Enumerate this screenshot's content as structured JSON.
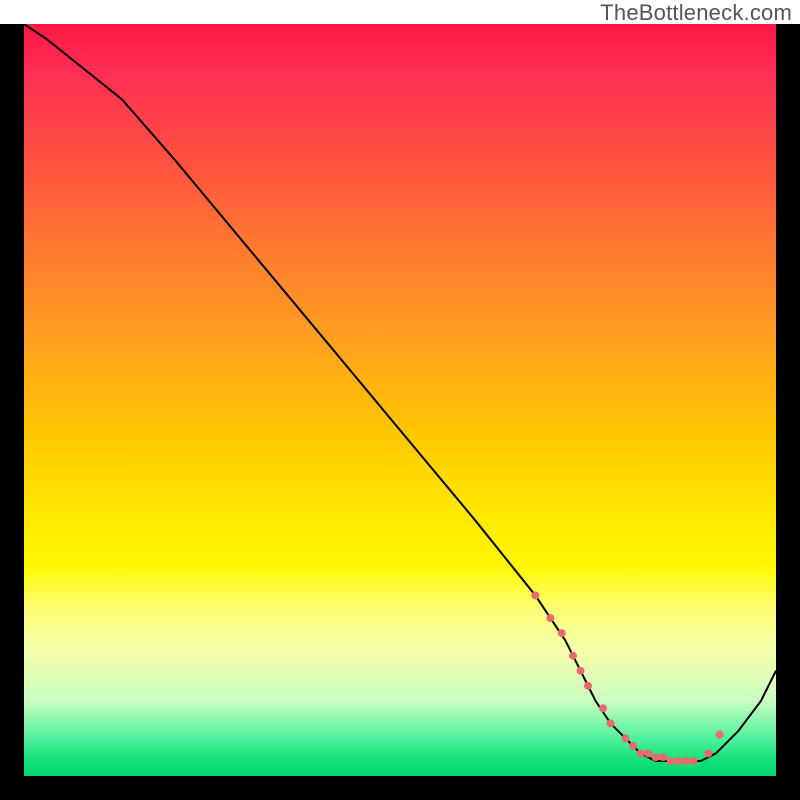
{
  "watermark": "TheBottleneck.com",
  "colors": {
    "curve_stroke": "#000000",
    "marker_fill": "#e86a6a",
    "background_black": "#000000"
  },
  "chart_data": {
    "type": "line",
    "title": "",
    "xlabel": "",
    "ylabel": "",
    "xlim": [
      0,
      100
    ],
    "ylim": [
      0,
      100
    ],
    "grid": false,
    "legend": false,
    "annotations": [
      "TheBottleneck.com"
    ],
    "series": [
      {
        "name": "curve",
        "x": [
          0,
          3,
          8,
          13,
          20,
          30,
          40,
          50,
          60,
          68,
          72,
          74,
          76,
          78,
          80,
          82,
          84,
          86,
          88,
          90,
          92,
          95,
          98,
          100
        ],
        "y": [
          100,
          98,
          94,
          90,
          82,
          70,
          58,
          46,
          34,
          24,
          18,
          14,
          10,
          7,
          5,
          3,
          2,
          2,
          2,
          2,
          3,
          6,
          10,
          14
        ]
      }
    ],
    "markers": {
      "name": "highlight-markers",
      "x": [
        68,
        70,
        71.5,
        73,
        74,
        75,
        77,
        78,
        80,
        81,
        82,
        83,
        84,
        85,
        86,
        87,
        88,
        89,
        91,
        92.5
      ],
      "y": [
        24,
        21,
        19,
        16,
        14,
        12,
        9,
        7,
        5,
        4,
        3,
        3,
        2.5,
        2.5,
        2,
        2,
        2,
        2,
        3,
        5.5
      ],
      "radius": 4
    },
    "gradient_stops": [
      {
        "pos": 0.0,
        "color": "#ff1744"
      },
      {
        "pos": 0.18,
        "color": "#ff5040"
      },
      {
        "pos": 0.42,
        "color": "#ffa020"
      },
      {
        "pos": 0.64,
        "color": "#ffe600"
      },
      {
        "pos": 0.84,
        "color": "#f2ffad"
      },
      {
        "pos": 0.95,
        "color": "#4ff09d"
      },
      {
        "pos": 1.0,
        "color": "#00d66c"
      }
    ]
  }
}
